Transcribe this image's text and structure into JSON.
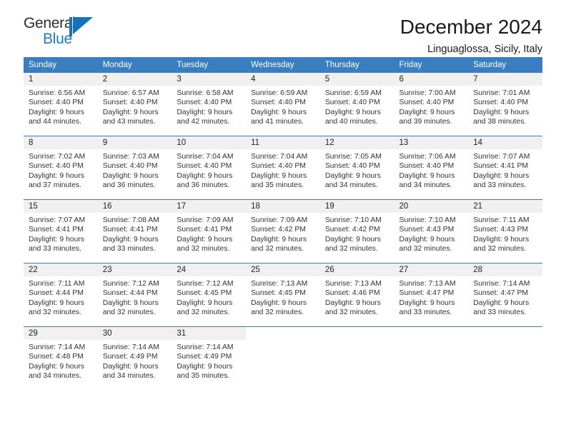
{
  "brand": {
    "name_part1": "General",
    "name_part2": "Blue",
    "logo_icon": "flag-triangle-icon",
    "accent_color": "#1573bb"
  },
  "header": {
    "title": "December 2024",
    "subtitle": "Linguaglossa, Sicily, Italy"
  },
  "theme": {
    "header_bg": "#3a7ebf",
    "daynum_bg": "#f0f0f0",
    "grid_line": "#3a7ebf",
    "text": "#333333"
  },
  "calendar": {
    "weekday_headers": [
      "Sunday",
      "Monday",
      "Tuesday",
      "Wednesday",
      "Thursday",
      "Friday",
      "Saturday"
    ],
    "weeks": [
      [
        {
          "day": "1",
          "sunrise": "Sunrise: 6:56 AM",
          "sunset": "Sunset: 4:40 PM",
          "daylight": "Daylight: 9 hours and 44 minutes."
        },
        {
          "day": "2",
          "sunrise": "Sunrise: 6:57 AM",
          "sunset": "Sunset: 4:40 PM",
          "daylight": "Daylight: 9 hours and 43 minutes."
        },
        {
          "day": "3",
          "sunrise": "Sunrise: 6:58 AM",
          "sunset": "Sunset: 4:40 PM",
          "daylight": "Daylight: 9 hours and 42 minutes."
        },
        {
          "day": "4",
          "sunrise": "Sunrise: 6:59 AM",
          "sunset": "Sunset: 4:40 PM",
          "daylight": "Daylight: 9 hours and 41 minutes."
        },
        {
          "day": "5",
          "sunrise": "Sunrise: 6:59 AM",
          "sunset": "Sunset: 4:40 PM",
          "daylight": "Daylight: 9 hours and 40 minutes."
        },
        {
          "day": "6",
          "sunrise": "Sunrise: 7:00 AM",
          "sunset": "Sunset: 4:40 PM",
          "daylight": "Daylight: 9 hours and 39 minutes."
        },
        {
          "day": "7",
          "sunrise": "Sunrise: 7:01 AM",
          "sunset": "Sunset: 4:40 PM",
          "daylight": "Daylight: 9 hours and 38 minutes."
        }
      ],
      [
        {
          "day": "8",
          "sunrise": "Sunrise: 7:02 AM",
          "sunset": "Sunset: 4:40 PM",
          "daylight": "Daylight: 9 hours and 37 minutes."
        },
        {
          "day": "9",
          "sunrise": "Sunrise: 7:03 AM",
          "sunset": "Sunset: 4:40 PM",
          "daylight": "Daylight: 9 hours and 36 minutes."
        },
        {
          "day": "10",
          "sunrise": "Sunrise: 7:04 AM",
          "sunset": "Sunset: 4:40 PM",
          "daylight": "Daylight: 9 hours and 36 minutes."
        },
        {
          "day": "11",
          "sunrise": "Sunrise: 7:04 AM",
          "sunset": "Sunset: 4:40 PM",
          "daylight": "Daylight: 9 hours and 35 minutes."
        },
        {
          "day": "12",
          "sunrise": "Sunrise: 7:05 AM",
          "sunset": "Sunset: 4:40 PM",
          "daylight": "Daylight: 9 hours and 34 minutes."
        },
        {
          "day": "13",
          "sunrise": "Sunrise: 7:06 AM",
          "sunset": "Sunset: 4:40 PM",
          "daylight": "Daylight: 9 hours and 34 minutes."
        },
        {
          "day": "14",
          "sunrise": "Sunrise: 7:07 AM",
          "sunset": "Sunset: 4:41 PM",
          "daylight": "Daylight: 9 hours and 33 minutes."
        }
      ],
      [
        {
          "day": "15",
          "sunrise": "Sunrise: 7:07 AM",
          "sunset": "Sunset: 4:41 PM",
          "daylight": "Daylight: 9 hours and 33 minutes."
        },
        {
          "day": "16",
          "sunrise": "Sunrise: 7:08 AM",
          "sunset": "Sunset: 4:41 PM",
          "daylight": "Daylight: 9 hours and 33 minutes."
        },
        {
          "day": "17",
          "sunrise": "Sunrise: 7:09 AM",
          "sunset": "Sunset: 4:41 PM",
          "daylight": "Daylight: 9 hours and 32 minutes."
        },
        {
          "day": "18",
          "sunrise": "Sunrise: 7:09 AM",
          "sunset": "Sunset: 4:42 PM",
          "daylight": "Daylight: 9 hours and 32 minutes."
        },
        {
          "day": "19",
          "sunrise": "Sunrise: 7:10 AM",
          "sunset": "Sunset: 4:42 PM",
          "daylight": "Daylight: 9 hours and 32 minutes."
        },
        {
          "day": "20",
          "sunrise": "Sunrise: 7:10 AM",
          "sunset": "Sunset: 4:43 PM",
          "daylight": "Daylight: 9 hours and 32 minutes."
        },
        {
          "day": "21",
          "sunrise": "Sunrise: 7:11 AM",
          "sunset": "Sunset: 4:43 PM",
          "daylight": "Daylight: 9 hours and 32 minutes."
        }
      ],
      [
        {
          "day": "22",
          "sunrise": "Sunrise: 7:11 AM",
          "sunset": "Sunset: 4:44 PM",
          "daylight": "Daylight: 9 hours and 32 minutes."
        },
        {
          "day": "23",
          "sunrise": "Sunrise: 7:12 AM",
          "sunset": "Sunset: 4:44 PM",
          "daylight": "Daylight: 9 hours and 32 minutes."
        },
        {
          "day": "24",
          "sunrise": "Sunrise: 7:12 AM",
          "sunset": "Sunset: 4:45 PM",
          "daylight": "Daylight: 9 hours and 32 minutes."
        },
        {
          "day": "25",
          "sunrise": "Sunrise: 7:13 AM",
          "sunset": "Sunset: 4:45 PM",
          "daylight": "Daylight: 9 hours and 32 minutes."
        },
        {
          "day": "26",
          "sunrise": "Sunrise: 7:13 AM",
          "sunset": "Sunset: 4:46 PM",
          "daylight": "Daylight: 9 hours and 32 minutes."
        },
        {
          "day": "27",
          "sunrise": "Sunrise: 7:13 AM",
          "sunset": "Sunset: 4:47 PM",
          "daylight": "Daylight: 9 hours and 33 minutes."
        },
        {
          "day": "28",
          "sunrise": "Sunrise: 7:14 AM",
          "sunset": "Sunset: 4:47 PM",
          "daylight": "Daylight: 9 hours and 33 minutes."
        }
      ],
      [
        {
          "day": "29",
          "sunrise": "Sunrise: 7:14 AM",
          "sunset": "Sunset: 4:48 PM",
          "daylight": "Daylight: 9 hours and 34 minutes."
        },
        {
          "day": "30",
          "sunrise": "Sunrise: 7:14 AM",
          "sunset": "Sunset: 4:49 PM",
          "daylight": "Daylight: 9 hours and 34 minutes."
        },
        {
          "day": "31",
          "sunrise": "Sunrise: 7:14 AM",
          "sunset": "Sunset: 4:49 PM",
          "daylight": "Daylight: 9 hours and 35 minutes."
        },
        {
          "day": "",
          "sunrise": "",
          "sunset": "",
          "daylight": ""
        },
        {
          "day": "",
          "sunrise": "",
          "sunset": "",
          "daylight": ""
        },
        {
          "day": "",
          "sunrise": "",
          "sunset": "",
          "daylight": ""
        },
        {
          "day": "",
          "sunrise": "",
          "sunset": "",
          "daylight": ""
        }
      ]
    ]
  }
}
